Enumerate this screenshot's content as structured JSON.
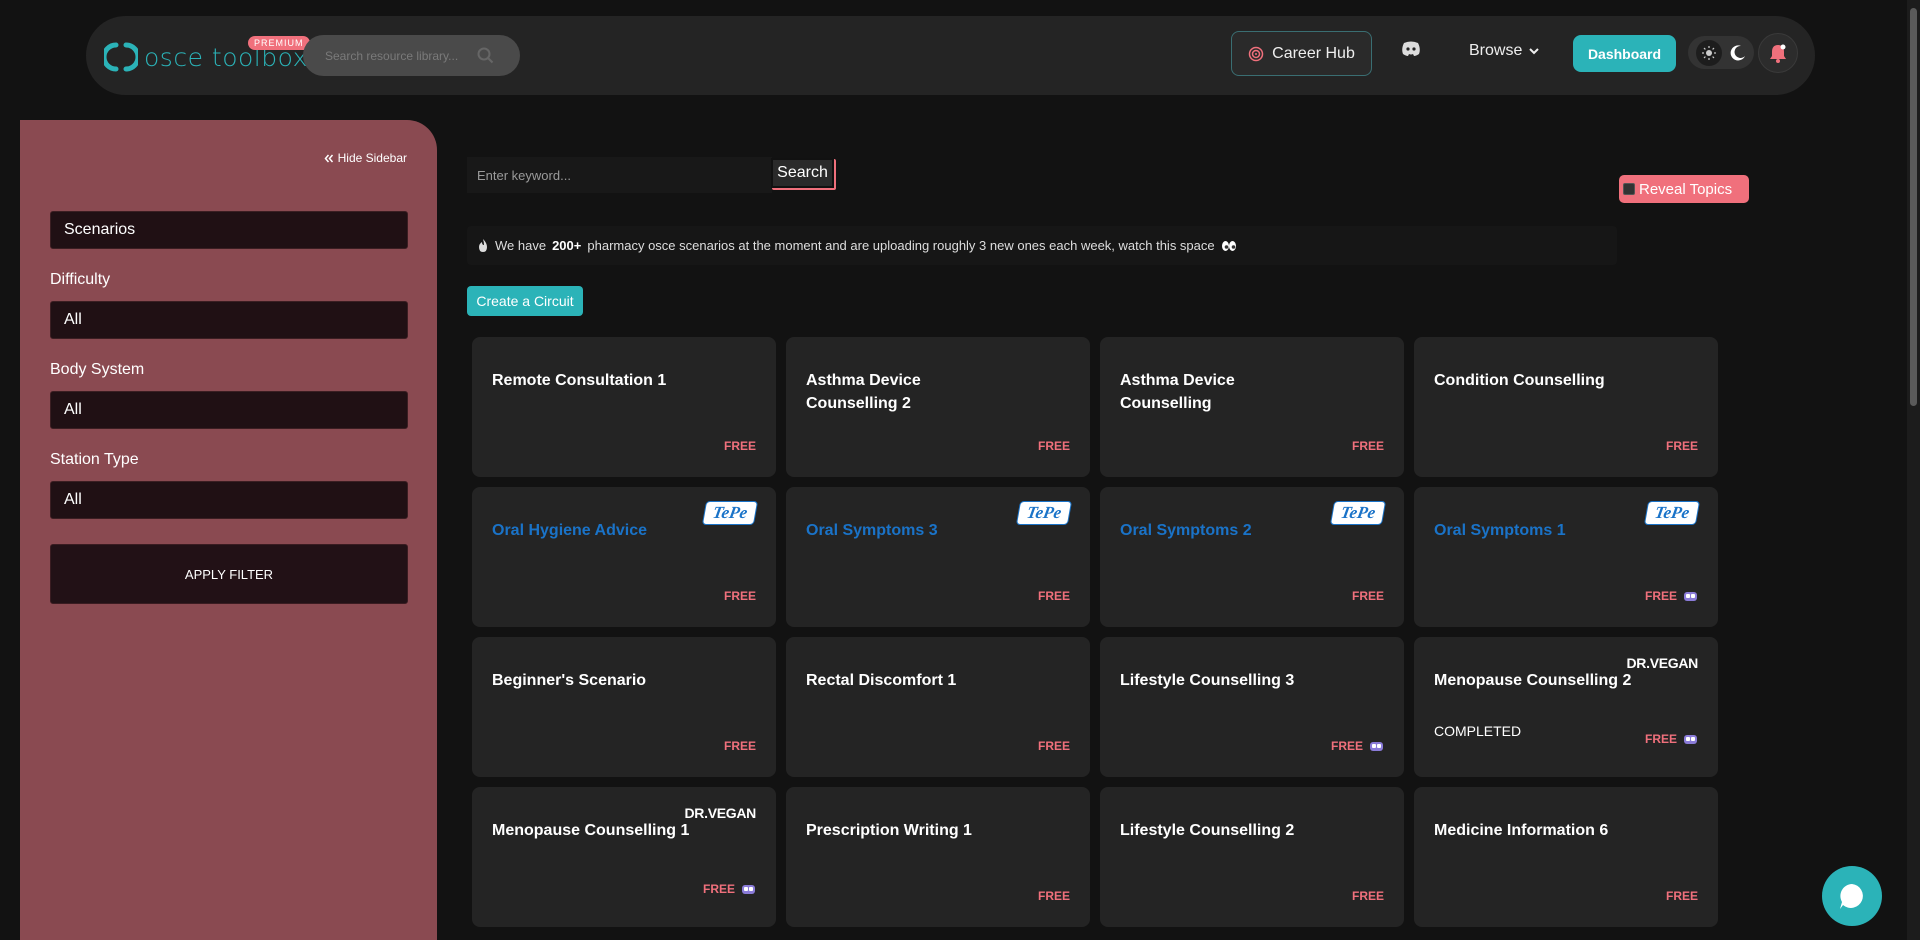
{
  "header": {
    "logo_text": "osce toolbox",
    "premium_badge": "PREMIUM",
    "search_placeholder": "Search resource library...",
    "career_hub": "Career Hub",
    "browse": "Browse",
    "dashboard": "Dashboard"
  },
  "sidebar": {
    "hide_label": "Hide Sidebar",
    "category_value": "Scenarios",
    "difficulty_label": "Difficulty",
    "difficulty_value": "All",
    "body_system_label": "Body System",
    "body_system_value": "All",
    "station_type_label": "Station Type",
    "station_type_value": "All",
    "apply_filter": "APPLY FILTER"
  },
  "main": {
    "keyword_placeholder": "Enter keyword...",
    "search_button": "Search",
    "reveal_topics": "Reveal Topics",
    "notice_prefix": "We have",
    "notice_bold": "200+",
    "notice_suffix": "pharmacy osce scenarios at the moment and are uploading roughly 3 new ones each week, watch this space",
    "create_circuit": "Create a Circuit"
  },
  "cards": [
    {
      "title": "Remote Consultation 1",
      "tag": "FREE"
    },
    {
      "title": "Asthma Device Counselling 2",
      "tag": "FREE"
    },
    {
      "title": "Asthma Device Counselling",
      "tag": "FREE"
    },
    {
      "title": "Condition Counselling",
      "tag": "FREE"
    },
    {
      "title": "Oral Hygiene Advice",
      "tag": "FREE",
      "sponsor": "TePe"
    },
    {
      "title": "Oral Symptoms 3",
      "tag": "FREE",
      "sponsor": "TePe"
    },
    {
      "title": "Oral Symptoms 2",
      "tag": "FREE",
      "sponsor": "TePe"
    },
    {
      "title": "Oral Symptoms 1",
      "tag": "FREE",
      "sponsor": "TePe"
    },
    {
      "title": "Beginner's Scenario",
      "tag": "FREE"
    },
    {
      "title": "Rectal Discomfort 1",
      "tag": "FREE"
    },
    {
      "title": "Lifestyle Counselling 3",
      "tag": "FREE"
    },
    {
      "title": "Menopause Counselling 2",
      "tag": "FREE",
      "sponsor": "DR.VEGAN",
      "status": "COMPLETED"
    },
    {
      "title": "Menopause Counselling 1",
      "tag": "FREE",
      "sponsor": "DR.VEGAN"
    },
    {
      "title": "Prescription Writing 1",
      "tag": "FREE"
    },
    {
      "title": "Lifestyle Counselling 2",
      "tag": "FREE"
    },
    {
      "title": "Medicine Information 6",
      "tag": "FREE"
    }
  ],
  "colors": {
    "accent_teal": "#2bb3b8",
    "accent_pink": "#f0707c",
    "sidebar_bg": "#8a4a51",
    "card_bg": "#242424",
    "sponsor_blue": "#1a73c8"
  }
}
